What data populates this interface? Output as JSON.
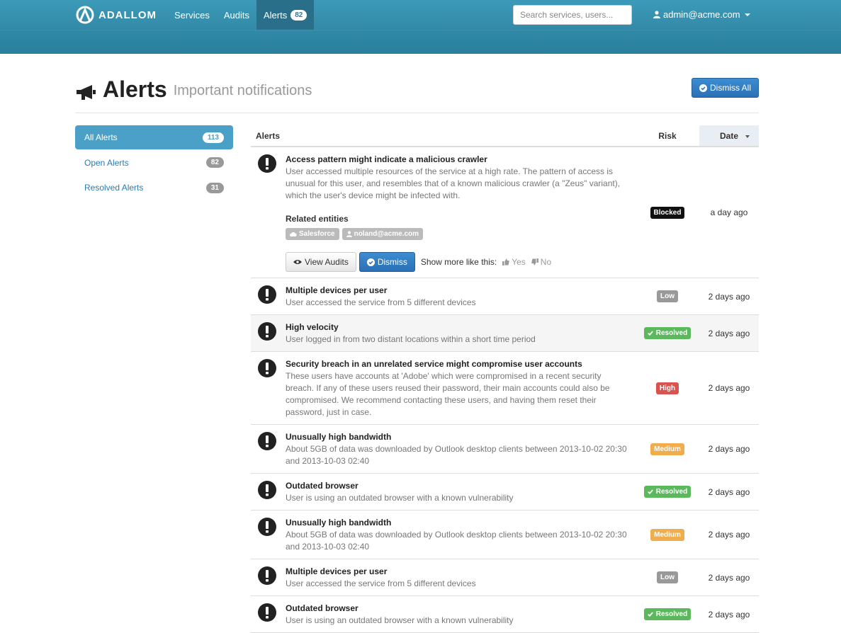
{
  "nav": {
    "logo_text": "ADALLOM",
    "items": [
      {
        "label": "Services"
      },
      {
        "label": "Audits"
      },
      {
        "label": "Alerts",
        "badge": "82"
      }
    ],
    "search_placeholder": "Search services, users...",
    "user": "admin@acme.com"
  },
  "page": {
    "title": "Alerts",
    "subtitle": "Important notifications",
    "dismiss_all": "Dismiss All"
  },
  "sidebar": {
    "items": [
      {
        "label": "All Alerts",
        "count": "113"
      },
      {
        "label": "Open Alerts",
        "count": "82"
      },
      {
        "label": "Resolved Alerts",
        "count": "31"
      }
    ]
  },
  "table": {
    "headers": {
      "alerts": "Alerts",
      "risk": "Risk",
      "date": "Date"
    },
    "rows": [
      {
        "title": "Access pattern might indicate a malicious crawler",
        "description": "User accessed multiple resources of the service at a high rate. The pattern of access is unusual for this user, and resembles that of a known malicious crawler (a \"Zeus\" variant), which the user's device might be infected with.",
        "risk": "Blocked",
        "date": "a day ago",
        "related_label": "Related entities",
        "entities": [
          "Salesforce",
          "noland@acme.com"
        ],
        "view_audits": "View Audits",
        "dismiss": "Dismiss",
        "show_more": "Show more like this:",
        "yes": "Yes",
        "no": "No"
      },
      {
        "title": "Multiple devices per user",
        "description": "User accessed the service from 5 different devices",
        "risk": "Low",
        "date": "2 days ago"
      },
      {
        "title": "High velocity",
        "description": "User logged in from two distant locations within a short time period",
        "risk": "Resolved",
        "date": "2 days ago"
      },
      {
        "title": "Security breach in an unrelated service might compromise user accounts",
        "description": "These users have accounts at 'Adobe' which were compromised in a recent security breach. If any of these users reused their password, their main accounts could also be compromised. We recommend contacting these users, and having them reset their password, just in case.",
        "risk": "High",
        "date": "2 days ago"
      },
      {
        "title": "Unusually high bandwidth",
        "description": "About 5GB of data was downloaded by Outlook desktop clients between 2013-10-02 20:30 and 2013-10-03 02:40",
        "risk": "Medium",
        "date": "2 days ago"
      },
      {
        "title": "Outdated browser",
        "description": "User is using an outdated browser with a known vulnerability",
        "risk": "Resolved",
        "date": "2 days ago"
      },
      {
        "title": "Unusually high bandwidth",
        "description": "About 5GB of data was downloaded by Outlook desktop clients between 2013-10-02 20:30 and 2013-10-03 02:40",
        "risk": "Medium",
        "date": "2 days ago"
      },
      {
        "title": "Multiple devices per user",
        "description": "User accessed the service from 5 different devices",
        "risk": "Low",
        "date": "2 days ago"
      },
      {
        "title": "Outdated browser",
        "description": "User is using an outdated browser with a known vulnerability",
        "risk": "Resolved",
        "date": "2 days ago"
      }
    ]
  }
}
